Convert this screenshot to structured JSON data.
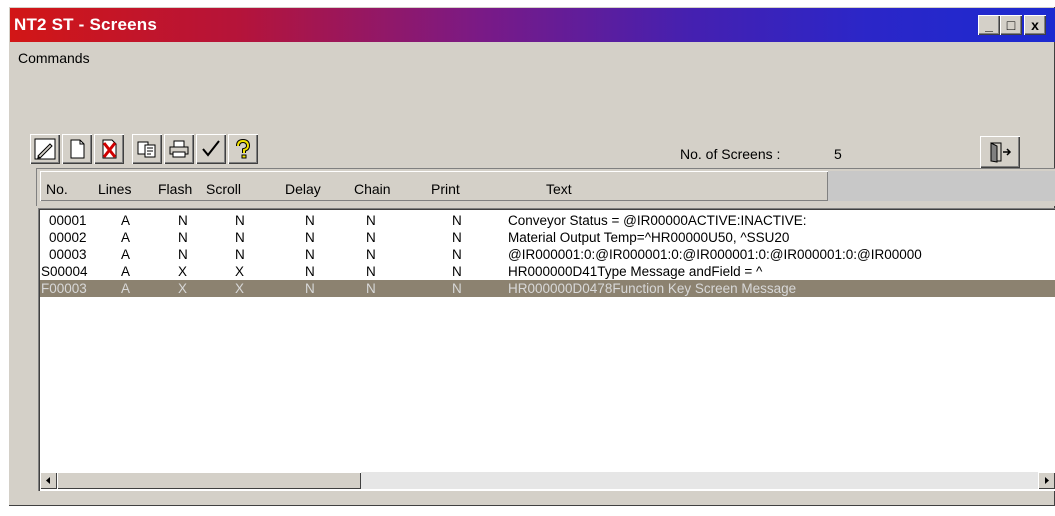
{
  "window": {
    "title": "NT2 ST - Screens",
    "minimize": "_",
    "maximize": "□",
    "close": "x"
  },
  "menu": [
    "Commands"
  ],
  "toolbar": {
    "icons": [
      "edit-icon",
      "new-icon",
      "delete-icon",
      "copy-icon",
      "print-icon",
      "check-icon",
      "help-icon"
    ],
    "exit_icon": "exit-icon"
  },
  "status": {
    "screens_label": "No. of Screens :",
    "screens_count": "5"
  },
  "table": {
    "columns": [
      "No.",
      "Lines",
      "Flash",
      "Scroll",
      "Delay",
      "Chain",
      "Print",
      "Text"
    ],
    "rows": [
      [
        "00001",
        "A",
        "N",
        "N",
        "N",
        "N",
        "N",
        "Conveyor Status    = @IR00000ACTIVE:INACTIVE:"
      ],
      [
        "00002",
        "A",
        "N",
        "N",
        "N",
        "N",
        "N",
        "Material Output Temp=^HR00000U50, ^SSU20"
      ],
      [
        "00003",
        "A",
        "N",
        "N",
        "N",
        "N",
        "N",
        "@IR000001:0:@IR000001:0:@IR000001:0:@IR000001:0:@IR00000"
      ],
      [
        "S00004",
        "A",
        "X",
        "X",
        "N",
        "N",
        "N",
        "HR000000D41Type Message andField = ^"
      ],
      [
        "F00003",
        "A",
        "X",
        "X",
        "N",
        "N",
        "N",
        "HR000000D0478Function Key    Screen Message"
      ]
    ],
    "selected_row": 4
  },
  "colors": {
    "face": "#d4d0c8",
    "selection": "#8c8270",
    "title_start": "#d21616",
    "title_end": "#1c2ad0"
  }
}
